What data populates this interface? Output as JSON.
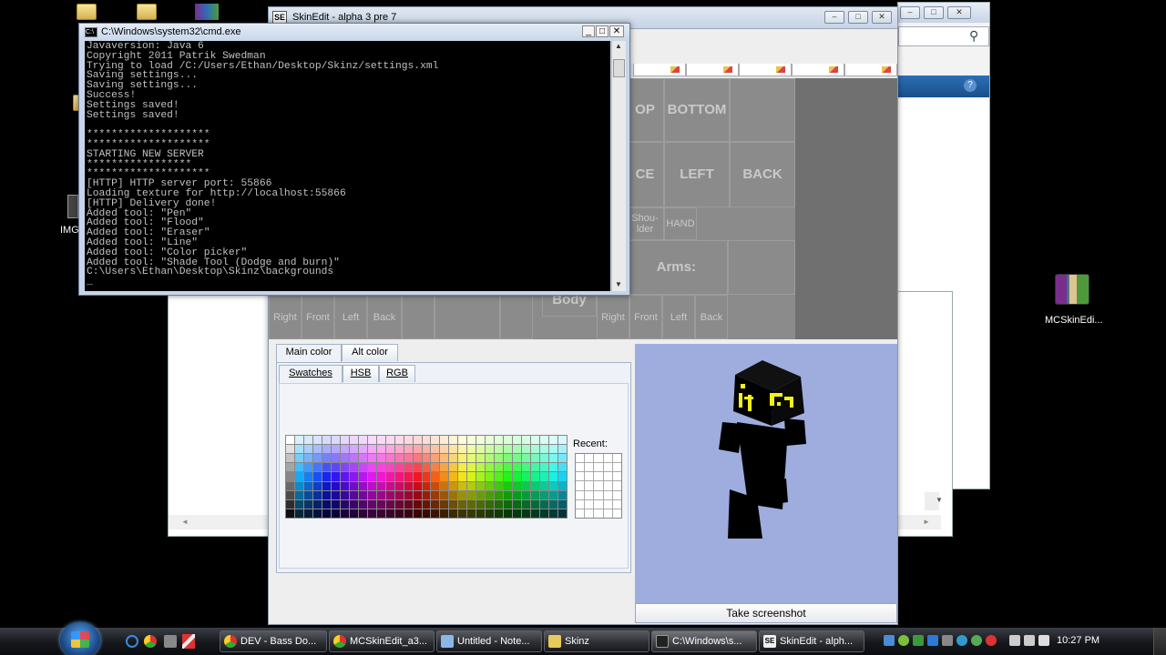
{
  "desktop": {
    "left_icon_label": "IMG",
    "right_icon_label": "MCSkinEdi..."
  },
  "skinedit": {
    "title": "SkinEdit - alpha 3 pre 7",
    "grid_labels": {
      "top": "OP",
      "bottom": "BOTTOM",
      "face": "CE",
      "left": "LEFT",
      "back": "BACK",
      "shoulder": "Shou-\nlder",
      "hand": "HAND",
      "arms": "Arms:",
      "body_upper": "Body",
      "body": "Body",
      "row_left": [
        "Right",
        "Front",
        "Left",
        "Back"
      ],
      "row_right": [
        "Right",
        "Front",
        "Left",
        "Back"
      ]
    },
    "color_tabs": [
      "Main color",
      "Alt color"
    ],
    "swatch_tabs": [
      "Swatches",
      "HSB",
      "RGB"
    ],
    "recent_label": "Recent:",
    "screenshot_button": "Take screenshot",
    "colors": {
      "grid_bg": "#8b8b8b",
      "preview_bg": "#9eadde",
      "skin_black": "#000000",
      "skin_yellow": "#f5f01a"
    }
  },
  "cmd": {
    "title": "C:\\Windows\\system32\\cmd.exe",
    "lines": [
      "Javaversion: Java 6",
      "Copyright 2011 Patrik Swedman",
      "Trying to load /C:/Users/Ethan/Desktop/Skinz/settings.xml",
      "Saving settings...",
      "Saving settings...",
      "Success!",
      "Settings saved!",
      "Settings saved!",
      "",
      "********************",
      "********************",
      "STARTING NEW SERVER",
      "*****************",
      "********************",
      "[HTTP] HTTP server port: 55866",
      "Loading texture for http://localhost:55866",
      "[HTTP] Delivery done!",
      "Added tool: \"Pen\"",
      "Added tool: \"Flood\"",
      "Added tool: \"Eraser\"",
      "Added tool: \"Line\"",
      "Added tool: \"Color picker\"",
      "Added tool: \"Shade Tool (Dodge and burn)\"",
      "C:\\Users\\Ethan\\Desktop\\Skinz\\backgrounds",
      "_"
    ]
  },
  "taskbar": {
    "items": [
      {
        "label": "DEV - Bass Do...",
        "icon_color": "#e9a33a"
      },
      {
        "label": "MCSkinEdit_a3...",
        "icon_color": "#e9a33a"
      },
      {
        "label": "Untitled - Note...",
        "icon_color": "#8cb6e8"
      },
      {
        "label": "Skinz",
        "icon_color": "#e9c95a"
      },
      {
        "label": "C:\\Windows\\s...",
        "icon_color": "#222222"
      },
      {
        "label": "SkinEdit - alph...",
        "icon_color": "#eeeeee"
      }
    ],
    "clock": "10:27 PM"
  }
}
